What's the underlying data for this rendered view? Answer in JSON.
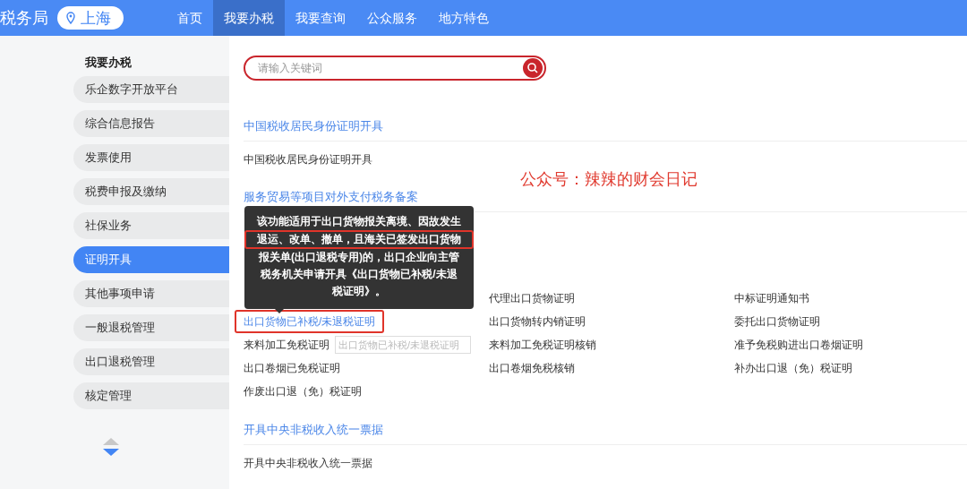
{
  "header": {
    "brand": "税务局",
    "location": "上海",
    "nav": [
      {
        "label": "首页",
        "selected": false
      },
      {
        "label": "我要办税",
        "selected": true
      },
      {
        "label": "我要查询",
        "selected": false
      },
      {
        "label": "公众服务",
        "selected": false
      },
      {
        "label": "地方特色",
        "selected": false
      }
    ]
  },
  "sidebar": {
    "title": "我要办税",
    "items": [
      {
        "label": "乐企数字开放平台",
        "selected": false
      },
      {
        "label": "综合信息报告",
        "selected": false
      },
      {
        "label": "发票使用",
        "selected": false
      },
      {
        "label": "税费申报及缴纳",
        "selected": false
      },
      {
        "label": "社保业务",
        "selected": false
      },
      {
        "label": "证明开具",
        "selected": true
      },
      {
        "label": "其他事项申请",
        "selected": false
      },
      {
        "label": "一般退税管理",
        "selected": false
      },
      {
        "label": "出口退税管理",
        "selected": false
      },
      {
        "label": "核定管理",
        "selected": false
      }
    ]
  },
  "search": {
    "placeholder": "请输入关键词"
  },
  "sections": [
    {
      "heading": "中国税收居民身份证明开具",
      "items": [
        {
          "label": "中国税收居民身份证明开具",
          "selected": false,
          "annotated": false
        }
      ]
    },
    {
      "heading": "服务贸易等项目对外支付税务备案"
    },
    {
      "items": [
        {
          "label": "代理出口货物证明",
          "selected": false,
          "annotated": false
        },
        {
          "label": "中标证明通知书",
          "selected": false,
          "annotated": false
        },
        {
          "label": "出口货物已补税/未退税证明",
          "selected": true,
          "annotated": true
        },
        {
          "label": "出口货物转内销证明",
          "selected": false,
          "annotated": false
        },
        {
          "label": "委托出口货物证明",
          "selected": false,
          "annotated": false
        },
        {
          "label": "来料加工免税证明",
          "selected": false,
          "annotated": false,
          "placeholder": "出口货物已补税/未退税证明"
        },
        {
          "label": "来料加工免税证明核销",
          "selected": false,
          "annotated": false
        },
        {
          "label": "准予免税购进出口卷烟证明",
          "selected": false,
          "annotated": false
        },
        {
          "label": "出口卷烟已免税证明",
          "selected": false,
          "annotated": false
        },
        {
          "label": "出口卷烟免税核销",
          "selected": false,
          "annotated": false
        },
        {
          "label": "补办出口退（免）税证明",
          "selected": false,
          "annotated": false
        },
        {
          "label": "作废出口退（免）税证明",
          "selected": false,
          "annotated": false
        }
      ]
    },
    {
      "heading": "开具中央非税收入统一票据",
      "items": [
        {
          "label": "开具中央非税收入统一票据",
          "selected": false,
          "annotated": false
        }
      ]
    }
  ],
  "tooltip": {
    "lines": [
      {
        "text": "该功能适用于出口货物报关离境、因故发生",
        "annotated": false
      },
      {
        "text": "退运、改单、撤单，且海关已签发出口货物",
        "annotated": true
      },
      {
        "text": "报关单(出口退税专用)的，出口企业向主管",
        "annotated": false
      },
      {
        "text": "税务机关申请开具《出口货物已补税/未退",
        "annotated": false
      },
      {
        "text": "税证明》。",
        "annotated": false
      }
    ]
  },
  "caption": "公众号：辣辣的财会日记"
}
